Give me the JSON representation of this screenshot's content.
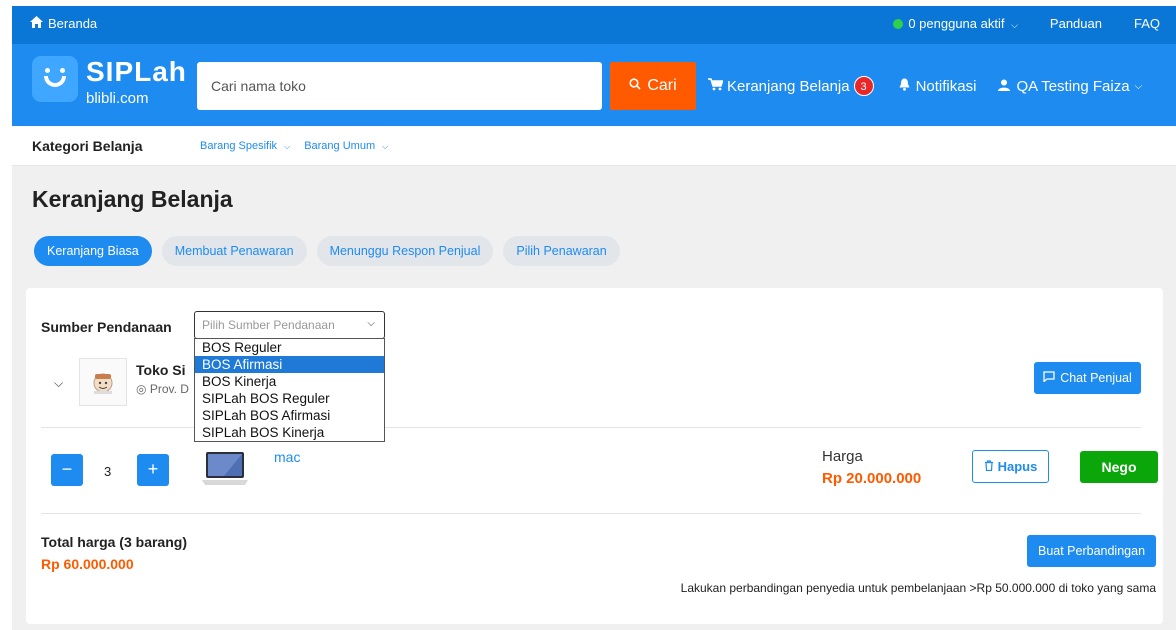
{
  "topbar": {
    "home_label": "Beranda",
    "active_users": "0 pengguna aktif",
    "guide": "Panduan",
    "faq": "FAQ"
  },
  "header": {
    "logo_title": "SIPLah",
    "logo_sub": "blibli.com",
    "search_placeholder": "Cari nama toko",
    "search_button": "Cari",
    "cart_label": "Keranjang Belanja",
    "cart_count": "3",
    "notifications": "Notifikasi",
    "user_name": "QA Testing Faiza"
  },
  "category_bar": {
    "title": "Kategori Belanja",
    "links": [
      "Barang Spesifik",
      "Barang Umum"
    ]
  },
  "page": {
    "title": "Keranjang Belanja",
    "tabs": [
      {
        "label": "Keranjang Biasa",
        "active": true
      },
      {
        "label": "Membuat Penawaran",
        "active": false
      },
      {
        "label": "Menunggu Respon Penjual",
        "active": false
      },
      {
        "label": "Pilih Penawaran",
        "active": false
      }
    ]
  },
  "funding": {
    "label": "Sumber Pendanaan",
    "placeholder": "Pilih Sumber Pendanaan",
    "options": [
      "BOS Reguler",
      "BOS Afirmasi",
      "BOS Kinerja",
      "SIPLah BOS Reguler",
      "SIPLah BOS Afirmasi",
      "SIPLah BOS Kinerja"
    ],
    "highlighted_index": 1
  },
  "store": {
    "name": "Toko Si",
    "location": "Prov. D",
    "chat_button": "Chat Penjual"
  },
  "item": {
    "quantity": "3",
    "minus": "−",
    "plus": "+",
    "name": "mac",
    "price_label": "Harga",
    "price": "Rp 20.000.000",
    "delete_button": "Hapus",
    "nego_button": "Nego"
  },
  "summary": {
    "total_label": "Total harga (3 barang)",
    "total_value": "Rp 60.000.000",
    "compare_button": "Buat Perbandingan",
    "note": "Lakukan perbandingan penyedia untuk pembelanjaan >Rp 50.000.000 di toko yang sama"
  },
  "colors": {
    "primary": "#1e8bf0",
    "topbar": "#0a77d6",
    "accent_orange": "#ff5a00",
    "success_green": "#0aa60a",
    "badge_red": "#e82828"
  }
}
